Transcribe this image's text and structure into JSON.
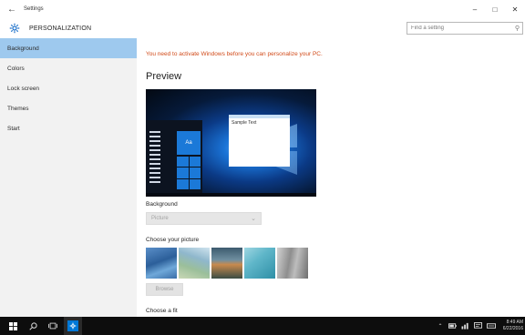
{
  "window": {
    "title": "Settings",
    "back_icon": "back-arrow-icon",
    "minimize_glyph": "–",
    "maximize_glyph": "□",
    "close_glyph": "✕"
  },
  "header": {
    "section_title": "PERSONALIZATION",
    "icon": "gear-icon",
    "search_placeholder": "Find a setting"
  },
  "sidebar": {
    "items": [
      {
        "label": "Background",
        "active": true
      },
      {
        "label": "Colors",
        "active": false
      },
      {
        "label": "Lock screen",
        "active": false
      },
      {
        "label": "Themes",
        "active": false
      },
      {
        "label": "Start",
        "active": false
      }
    ]
  },
  "main": {
    "warning": "You need to activate Windows before you can personalize your PC.",
    "preview_title": "Preview",
    "preview": {
      "sample_text": "Sample Text",
      "tile_label": "Aa"
    },
    "background_label": "Background",
    "background_value": "Picture",
    "choose_picture_label": "Choose your picture",
    "pictures": [
      "picture-1",
      "picture-2",
      "picture-3",
      "picture-4",
      "picture-5"
    ],
    "browse_label": "Browse",
    "choose_fit_label": "Choose a fit"
  },
  "taskbar": {
    "time": "8:49 AM",
    "date": "6/22/2016"
  },
  "colors": {
    "accent": "#0078d7",
    "nav_active": "#9ec9ee",
    "warning": "#d14b1a",
    "taskbar": "#0d0d0d"
  }
}
